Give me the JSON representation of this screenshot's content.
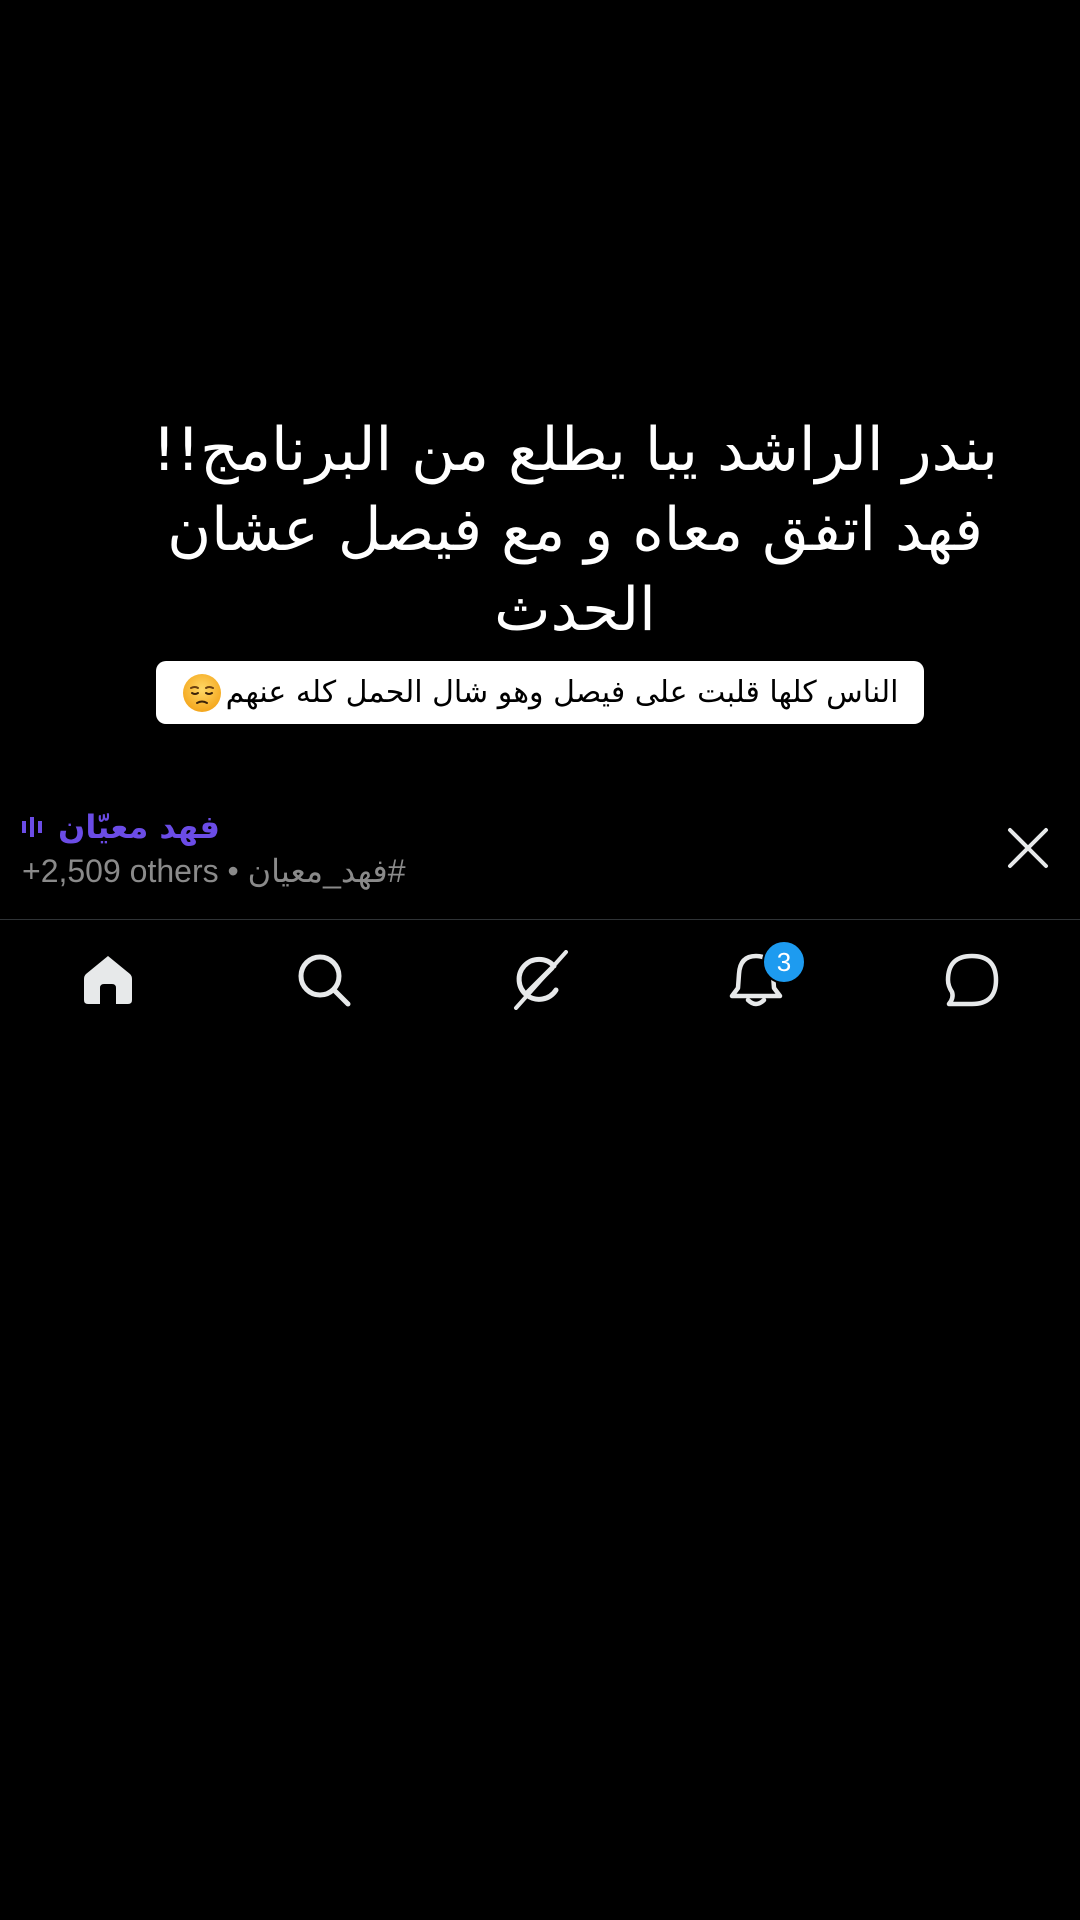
{
  "post": {
    "headline": "بندر الراشد يبا يطلع من البرنامج!!\nفهد اتفق معاه و مع فيصل عشان\nالحدث",
    "caption": "الناس كلها قلبت على فيصل وهو شال الحمل كله عنهم",
    "caption_emoji": "pensive-face-icon"
  },
  "now_playing": {
    "title": "فهد معيّان",
    "hashtag": "#فهد_معيان",
    "separator": "•",
    "others": "+2,509 others",
    "accent_color": "#6b4ce6"
  },
  "tabbar": {
    "tabs": [
      {
        "name": "home",
        "icon": "home-icon",
        "active": true
      },
      {
        "name": "search",
        "icon": "search-icon"
      },
      {
        "name": "grok",
        "icon": "grok-icon"
      },
      {
        "name": "notifications",
        "icon": "bell-icon",
        "badge": "3"
      },
      {
        "name": "messages",
        "icon": "chat-bubble-icon"
      }
    ],
    "badge_color": "#1d9bf0"
  }
}
